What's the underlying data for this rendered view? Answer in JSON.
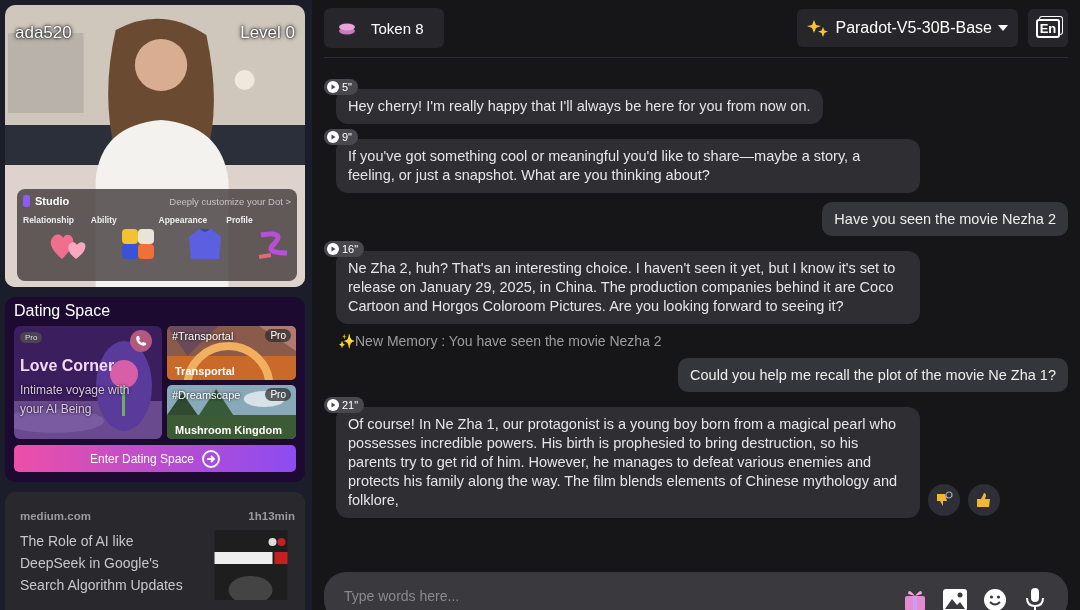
{
  "profile": {
    "username": "ada520",
    "level": "Level 0",
    "studio": {
      "title": "Studio",
      "link": "Deeply customize your Dot >",
      "items": [
        {
          "label": "Relationship",
          "kind": "heart"
        },
        {
          "label": "Ability",
          "kind": "cube"
        },
        {
          "label": "Appearance",
          "kind": "sweater"
        },
        {
          "label": "Profile",
          "kind": "ribbon"
        }
      ]
    }
  },
  "dating_space": {
    "title": "Dating Space",
    "main": {
      "badge": "Pro",
      "title": "Love Corner",
      "subtitle": "Intimate voyage with your AI Being"
    },
    "scenes": [
      {
        "tag": "#Transportal",
        "badge": "Pro",
        "title": "Transportal",
        "kind": "sunset"
      },
      {
        "tag": "#Dreamscape",
        "badge": "Pro",
        "title": "Mushroom Kingdom",
        "kind": "forest"
      }
    ],
    "button": "Enter Dating Space"
  },
  "news": {
    "source": "medium.com",
    "time": "1h13min",
    "title": "The Role of AI like DeepSeek in Google's Search Algorithm Updates"
  },
  "header": {
    "token": "Token 8",
    "model": "Paradot-V5-30B-Base",
    "lang_button": "En"
  },
  "messages": [
    {
      "kind": "bot",
      "duration": "5\"",
      "text": "Hey cherry! I'm really happy that I'll always be here for you from now on."
    },
    {
      "kind": "bot",
      "duration": "9\"",
      "text": "If you've got something cool or meaningful you'd like to share—maybe a story, a feeling, or just a snapshot. What are you thinking about?"
    },
    {
      "kind": "user",
      "text": "Have you seen the movie Nezha 2"
    },
    {
      "kind": "bot",
      "duration": "16\"",
      "text": "Ne Zha 2, huh? That's an interesting choice. I haven't seen it yet, but I know it's set to release on January 29, 2025, in China. The production companies behind it are Coco Cartoon and Horgos Coloroom Pictures. Are you looking forward to seeing it?"
    },
    {
      "kind": "memory",
      "text": "✨New Memory : You have seen the movie Nezha 2"
    },
    {
      "kind": "user",
      "text": "Could you help me recall the plot of the movie Ne Zha 1?"
    },
    {
      "kind": "bot",
      "duration": "21\"",
      "text": "Of course! In Ne Zha 1, our protagonist is a young boy born from a magical pearl who possesses incredible powers. His birth is prophesied to bring destruction, so his parents try to get rid of him. However, he manages to defeat various enemies and protects his family along the way. The film blends elements of Chinese mythology and folklore,",
      "reactions": true
    }
  ],
  "input": {
    "placeholder": "Type words here..."
  }
}
